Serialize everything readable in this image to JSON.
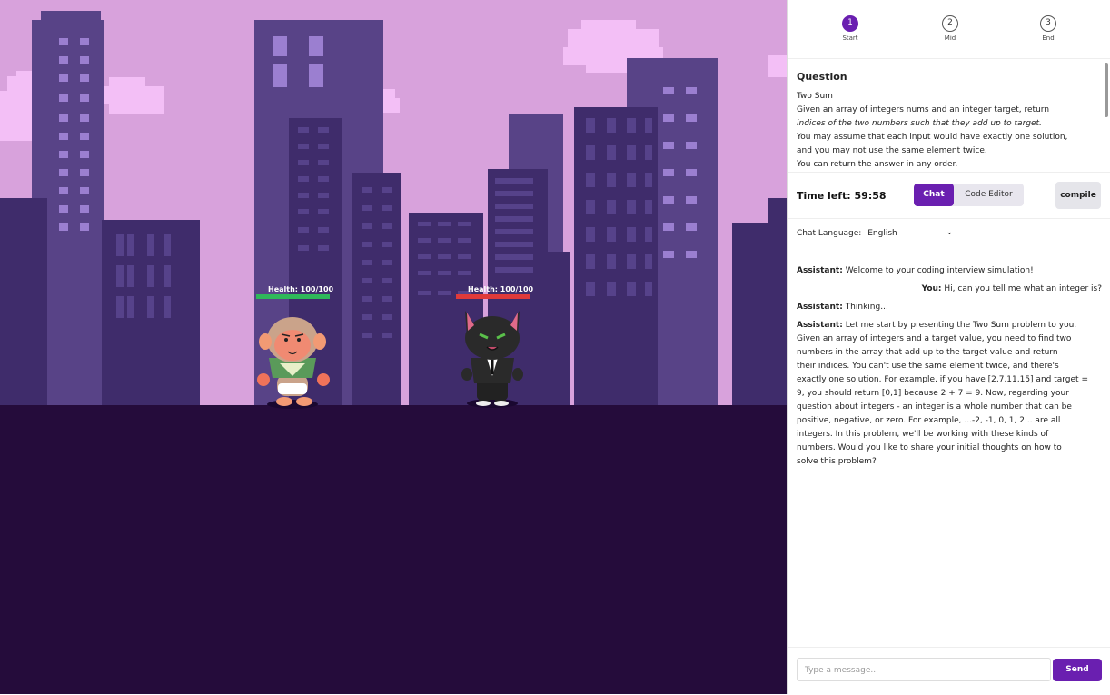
{
  "scene": {
    "player": {
      "health_label": "Health: 100/100",
      "health": 1.0,
      "bar_color": "#2fb85a"
    },
    "enemy": {
      "health_label": "Health: 100/100",
      "health": 1.0,
      "bar_color": "#e03a3a"
    },
    "colors": {
      "sky": "#d8a2dc",
      "ground": "#250c3b",
      "cloud": "#f3bff6"
    }
  },
  "stepper": {
    "steps": [
      {
        "number": "1",
        "label": "Start",
        "active": true
      },
      {
        "number": "2",
        "label": "Mid",
        "active": false
      },
      {
        "number": "3",
        "label": "End",
        "active": false
      }
    ]
  },
  "question": {
    "heading": "Question",
    "title": "Two Sum",
    "lines": [
      "Given an array of integers nums and an integer target, return",
      "indices of the two numbers such that they add up to target.",
      "You may assume that each input would have exactly one solution,",
      "and you may not use the same element twice.",
      "You can return the answer in any order."
    ]
  },
  "toolbar": {
    "timer": "Time left: 59:58",
    "tabs": [
      {
        "label": "Chat",
        "active": true
      },
      {
        "label": "Code Editor",
        "active": false
      }
    ],
    "compile_label": "compile"
  },
  "chat": {
    "language_label": "Chat Language:",
    "language_value": "English",
    "messages": [
      {
        "speaker": "Assistant:",
        "text": "Welcome to your coding interview simulation!",
        "role": "assistant"
      },
      {
        "speaker": "You:",
        "text": "Hi, can you tell me what an integer is?",
        "role": "user"
      },
      {
        "speaker": "Assistant:",
        "text": "Thinking...",
        "role": "assistant"
      },
      {
        "speaker": "Assistant:",
        "role": "assistant",
        "lines": [
          "Let me start by presenting the Two Sum problem to you.",
          "Given an array of integers and a target value, you need to find two",
          "numbers in the array that add up to the target value and return",
          "their indices. You can't use the same element twice, and there's",
          "exactly one solution. For example, if you have [2,7,11,15] and target =",
          "9, you should return [0,1] because 2 + 7 = 9. Now, regarding your",
          "question about integers - an integer is a whole number that can be",
          "positive, negative, or zero. For example, ...-2, -1, 0, 1, 2... are all",
          "integers. In this problem, we'll be working with these kinds of",
          "numbers. Would you like to share your initial thoughts on how to",
          "solve this problem?"
        ]
      }
    ]
  },
  "composer": {
    "placeholder": "Type a message...",
    "send_label": "Send"
  }
}
